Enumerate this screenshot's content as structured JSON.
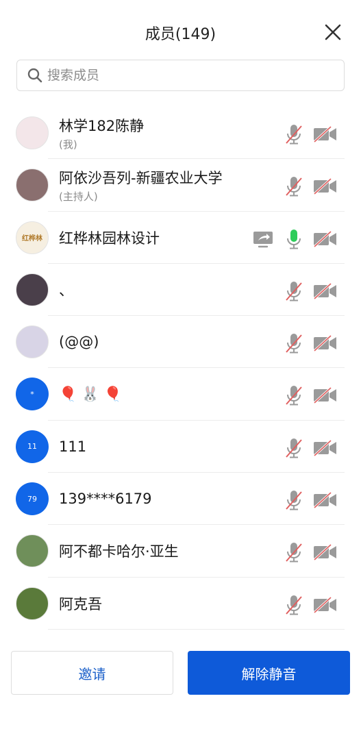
{
  "header": {
    "title": "成员(149)"
  },
  "search": {
    "placeholder": "搜索成员"
  },
  "members": [
    {
      "name": "林学182陈静",
      "sub": "(我)",
      "avatar": {
        "type": "photo",
        "color": "#f3e6e9"
      },
      "mic": "muted",
      "camera": "off"
    },
    {
      "name": "阿依沙吾列-新疆农业大学",
      "sub": "(主持人)",
      "avatar": {
        "type": "photo",
        "color": "#8a6f6f"
      },
      "mic": "muted",
      "camera": "off"
    },
    {
      "name": "红桦林园林设计",
      "sub": "",
      "avatar": {
        "type": "logo",
        "text": "红桦林",
        "color": "#f6efe1"
      },
      "sharing": true,
      "mic": "active",
      "camera": "off"
    },
    {
      "name": "、",
      "sub": "",
      "avatar": {
        "type": "photo",
        "color": "#4a3f4a"
      },
      "mic": "muted",
      "camera": "off"
    },
    {
      "name": "(@@)",
      "sub": "",
      "avatar": {
        "type": "photo",
        "color": "#d8d4e6"
      },
      "mic": "muted",
      "camera": "off"
    },
    {
      "name": "🎈 🐰 🎈",
      "sub": "",
      "avatar": {
        "type": "initials",
        "text": "*",
        "color": "#1166e8"
      },
      "mic": "muted",
      "camera": "off"
    },
    {
      "name": "111",
      "sub": "",
      "avatar": {
        "type": "initials",
        "text": "11",
        "color": "#1166e8"
      },
      "mic": "muted",
      "camera": "off"
    },
    {
      "name": "139****6179",
      "sub": "",
      "avatar": {
        "type": "initials",
        "text": "79",
        "color": "#1166e8"
      },
      "mic": "muted",
      "camera": "off"
    },
    {
      "name": "阿不都卡哈尔·亚生",
      "sub": "",
      "avatar": {
        "type": "photo",
        "color": "#6f8f5a"
      },
      "mic": "muted",
      "camera": "off"
    },
    {
      "name": "阿克吾",
      "sub": "",
      "avatar": {
        "type": "photo",
        "color": "#5a7a3a"
      },
      "mic": "muted",
      "camera": "off"
    }
  ],
  "footer": {
    "invite_label": "邀请",
    "unmute_label": "解除静音"
  },
  "colors": {
    "accent": "#0e5ad9",
    "mic_active": "#2ecc5a",
    "muted_slash": "#e06060",
    "icon_gray": "#9a9a9a"
  }
}
